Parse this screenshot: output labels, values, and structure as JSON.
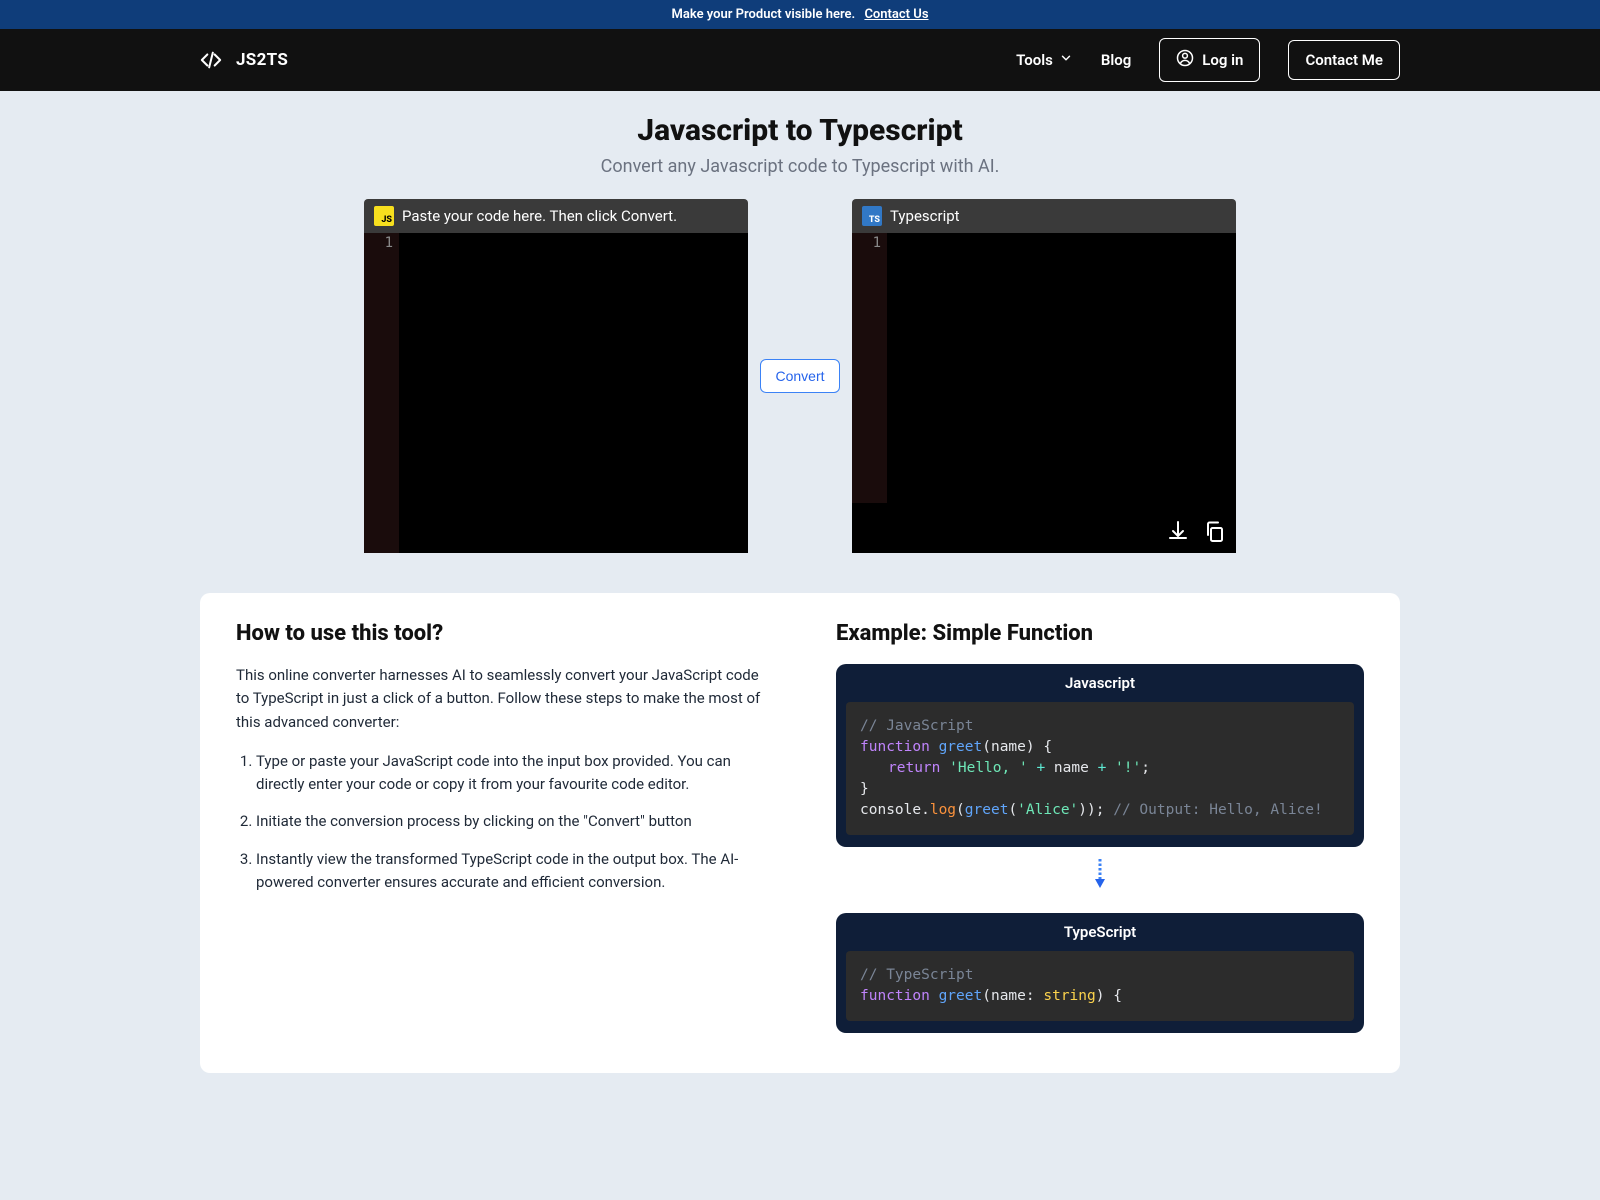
{
  "announcement": {
    "text": "Make your Product visible here.",
    "link_label": "Contact Us"
  },
  "nav": {
    "brand": "JS2TS",
    "tools_label": "Tools",
    "blog_label": "Blog",
    "login_label": "Log in",
    "contact_label": "Contact Me"
  },
  "hero": {
    "title": "Javascript to Typescript",
    "subtitle": "Convert any Javascript code to Typescript with AI."
  },
  "editors": {
    "input_placeholder_label": "Paste your code here. Then click Convert.",
    "output_label": "Typescript",
    "input_badge": "JS",
    "output_badge": "TS",
    "line_one": "1",
    "convert_label": "Convert"
  },
  "howto": {
    "heading": "How to use this tool?",
    "intro": "This online converter harnesses AI to seamlessly convert your JavaScript code to TypeScript in just a click of a button. Follow these steps to make the most of this advanced converter:",
    "steps": [
      "Type or paste your JavaScript code into the input box provided. You can directly enter your code or copy it from your favourite code editor.",
      "Initiate the conversion process by clicking on the \"Convert\" button",
      "Instantly view the transformed TypeScript code in the output box. The AI-powered converter ensures accurate and efficient conversion."
    ]
  },
  "example": {
    "heading": "Example: Simple Function",
    "js_title": "Javascript",
    "ts_title": "TypeScript",
    "js_code": {
      "c1": "// JavaScript",
      "kw_function": "function",
      "fn_name": "greet",
      "param_open": "(name)  {",
      "kw_return": "return",
      "str_hello": "'Hello, '",
      "op_plus1": "+",
      "ident_name": "name",
      "op_plus2": "+",
      "str_bang": "'!'",
      "semi": ";",
      "close_brace": "}",
      "console": "console",
      "dot": ".",
      "log": "log",
      "open_p": "(",
      "greet_call": "greet",
      "open_p2": "(",
      "str_alice": "'Alice'",
      "close_pp": "));",
      "out_comment": "// Output: Hello, Alice!"
    },
    "ts_code": {
      "c1": "// TypeScript",
      "kw_function": "function",
      "fn_name": "greet",
      "param_open": "(",
      "ident_name": "name",
      "colon": ":",
      "type_string": "string",
      "close_sig": ")  {"
    }
  }
}
